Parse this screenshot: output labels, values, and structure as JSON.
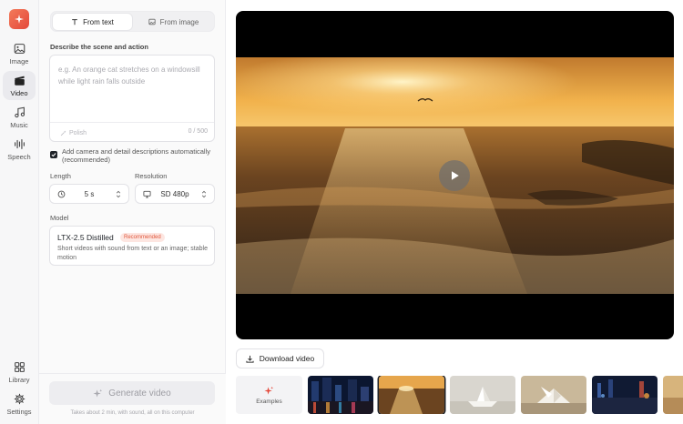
{
  "nav": {
    "items": [
      {
        "label": "Image",
        "icon": "image-icon"
      },
      {
        "label": "Video",
        "icon": "video-clapper-icon",
        "active": true
      },
      {
        "label": "Music",
        "icon": "music-note-icon"
      },
      {
        "label": "Speech",
        "icon": "waveform-icon"
      }
    ],
    "bottom": [
      {
        "label": "Library",
        "icon": "grid-icon"
      },
      {
        "label": "Settings",
        "icon": "gear-icon"
      }
    ]
  },
  "mode_tabs": [
    {
      "label": "From text",
      "active": true
    },
    {
      "label": "From image",
      "active": false
    }
  ],
  "prompt": {
    "label": "Describe the scene and action",
    "placeholder": "e.g. An orange cat stretches on a windowsill while light rain falls outside",
    "polish_label": "Polish",
    "counter": "0 / 500"
  },
  "auto_describe": {
    "checked": true,
    "text": "Add camera and detail descriptions automatically (recommended)"
  },
  "length": {
    "label": "Length",
    "value": "5 s"
  },
  "resolution": {
    "label": "Resolution",
    "value": "SD 480p"
  },
  "model": {
    "label": "Model",
    "name": "LTX-2.5 Distilled",
    "badge": "Recommended",
    "description": "Short videos with sound from text or an image; stable motion"
  },
  "generate": {
    "label": "Generate video",
    "note": "Takes about 2 min, with sound, all on this computer"
  },
  "preview": {
    "download_label": "Download video",
    "examples_label": "Examples"
  },
  "colors": {
    "accent": "#e4483a",
    "badge_bg": "#fde6e1",
    "badge_text": "#e0583e"
  }
}
